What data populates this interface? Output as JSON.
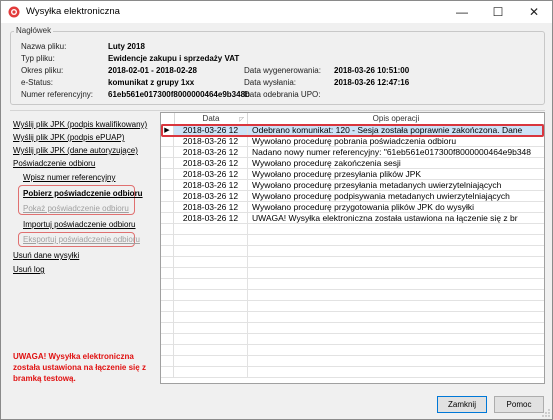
{
  "window": {
    "title": "Wysyłka elektroniczna",
    "controls": {
      "minimize": "—",
      "maximize": "☐",
      "close": "✕"
    }
  },
  "header": {
    "legend": "Nagłówek",
    "fields": {
      "nazwa_label": "Nazwa pliku:",
      "nazwa_value": "Luty 2018",
      "typ_label": "Typ pliku:",
      "typ_value": "Ewidencje zakupu i sprzedaży VAT",
      "okres_label": "Okres pliku:",
      "okres_value": "2018-02-01 - 2018-02-28",
      "estatus_label": "e-Status:",
      "estatus_value": "komunikat z grupy 1xx",
      "numer_label": "Numer referencyjny:",
      "numer_value": "61eb561e017300f8000000464e9b348b",
      "wygen_label": "Data wygenerowania:",
      "wygen_value": "2018-03-26 10:51:00",
      "wyslania_label": "Data wysłania:",
      "wyslania_value": "2018-03-26 12:47:16",
      "upo_label": "Data odebrania UPO:",
      "upo_value": ""
    }
  },
  "actions": {
    "send_qualified": "Wyślij plik JPK (podpis kwalifikowany)",
    "send_epuap": "Wyślij plik JPK (podpis ePUAP)",
    "send_auth": "Wyślij plik JPK (dane autoryzujące)",
    "upo": "Poświadczenie odbioru",
    "enter_ref": "Wpisz numer referencyjny",
    "fetch_upo": "Pobierz poświadczenie odbioru",
    "show_upo": "Pokaż poświadczenie odbioru",
    "import_upo": "Importuj poświadczenie odbioru",
    "export_upo": "Eksportuj poświadczenie odbioru",
    "delete_send": "Usuń dane wysyłki",
    "delete_log": "Usuń log"
  },
  "warning": "UWAGA! Wysyłka elektroniczna została ustawiona na łączenie się z bramką testową.",
  "grid": {
    "columns": {
      "date": "Data",
      "desc": "Opis operacji"
    },
    "rows": [
      {
        "date": "2018-03-26 12",
        "desc": "Odebrano komunikat: 120 - Sesja została poprawnie zakończona. Dane"
      },
      {
        "date": "2018-03-26 12",
        "desc": "Wywołano procedurę pobrania poświadczenia odbioru"
      },
      {
        "date": "2018-03-26 12",
        "desc": "Nadano nowy numer referencyjny: \"61eb561e017300f8000000464e9b348"
      },
      {
        "date": "2018-03-26 12",
        "desc": "Wywołano procedurę zakończenia sesji"
      },
      {
        "date": "2018-03-26 12",
        "desc": "Wywołano procedurę przesyłania plików JPK"
      },
      {
        "date": "2018-03-26 12",
        "desc": "Wywołano procedurę przesyłania metadanych uwierzytelniających"
      },
      {
        "date": "2018-03-26 12",
        "desc": "Wywołano procedurę podpisywania metadanych uwierzytelniających"
      },
      {
        "date": "2018-03-26 12",
        "desc": "Wywołano procedurę przygotowania plików JPK do wysyłki"
      },
      {
        "date": "2018-03-26 12",
        "desc": "UWAGA! Wysyłka elektroniczna została ustawiona na łączenie się z br"
      }
    ],
    "selected_marker": "▶"
  },
  "buttons": {
    "close": "Zamknij",
    "help": "Pomoc"
  }
}
